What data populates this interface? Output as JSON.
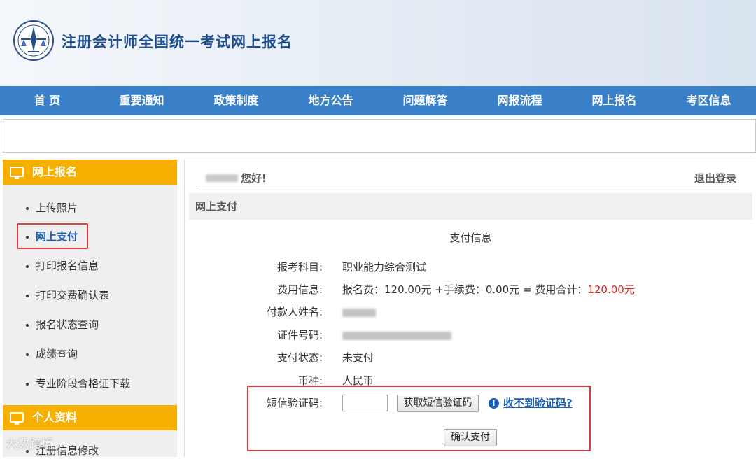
{
  "header": {
    "title": "注册会计师全国统一考试网上报名"
  },
  "nav": [
    "首 页",
    "重要通知",
    "政策制度",
    "地方公告",
    "问题解答",
    "网报流程",
    "网上报名",
    "考区信息"
  ],
  "sidebar": {
    "section1": "网上报名",
    "items": [
      "上传照片",
      "网上支付",
      "打印报名信息",
      "打印交费确认表",
      "报名状态查询",
      "成绩查询",
      "专业阶段合格证下载"
    ],
    "active_index": 1,
    "section2": "个人资料",
    "items2": [
      "注册信息修改"
    ]
  },
  "main": {
    "greeting": "您好!",
    "logout": "退出登录",
    "section": "网上支付",
    "pay_title": "支付信息",
    "fields": {
      "subject_label": "报考科目:",
      "subject_value": "职业能力综合测试",
      "fee_label": "费用信息:",
      "fee_text": "报名费：120.00元 +手续费：0.00元 = 费用合计：",
      "fee_total": "120.00元",
      "payer_label": "付款人姓名:",
      "id_label": "证件号码:",
      "status_label": "支付状态:",
      "status_value": "未支付",
      "currency_label": "币种:",
      "currency_value": "人民币",
      "sms_label": "短信验证码:"
    },
    "get_code_button": "获取短信验证码",
    "no_code_link": "收不到验证码?",
    "confirm_button": "确认支付"
  },
  "watermark": "大数跨境",
  "colors": {
    "nav": "#3a80c8",
    "sidebar_head": "#f7b000",
    "highlight_box": "#e0393e",
    "link": "#1a5fb4",
    "alert": "#d9231d"
  }
}
